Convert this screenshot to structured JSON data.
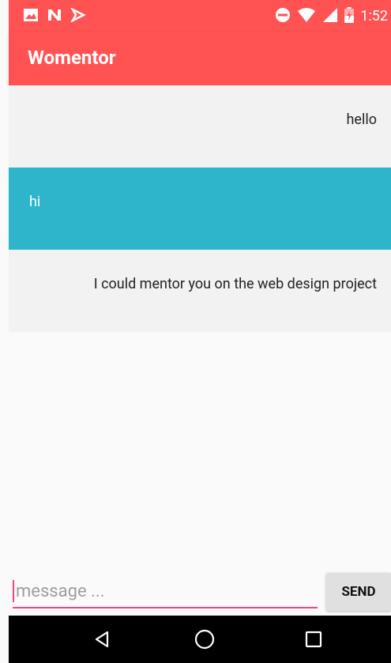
{
  "status_bar": {
    "time": "1:52",
    "left_icons": [
      "image-icon",
      "n-icon",
      "download-icon"
    ],
    "right_icons": [
      "do-not-disturb-icon",
      "wifi-icon",
      "signal-icon",
      "battery-icon"
    ],
    "color": "#ff5252"
  },
  "app_bar": {
    "title": "Womentor"
  },
  "messages": [
    {
      "text": "hello",
      "side": "theirs"
    },
    {
      "text": "hi",
      "side": "mine"
    },
    {
      "text": "I could mentor you on the web design project",
      "side": "theirs"
    }
  ],
  "composer": {
    "placeholder": "message ...",
    "value": "",
    "send_label": "SEND"
  },
  "nav_bar": {
    "buttons": [
      "back-icon",
      "home-icon",
      "recents-icon"
    ]
  },
  "colors": {
    "accent": "#ff4081",
    "primary": "#ff5252",
    "my_message": "#2eb5cc",
    "their_message": "#f2f2f2"
  }
}
